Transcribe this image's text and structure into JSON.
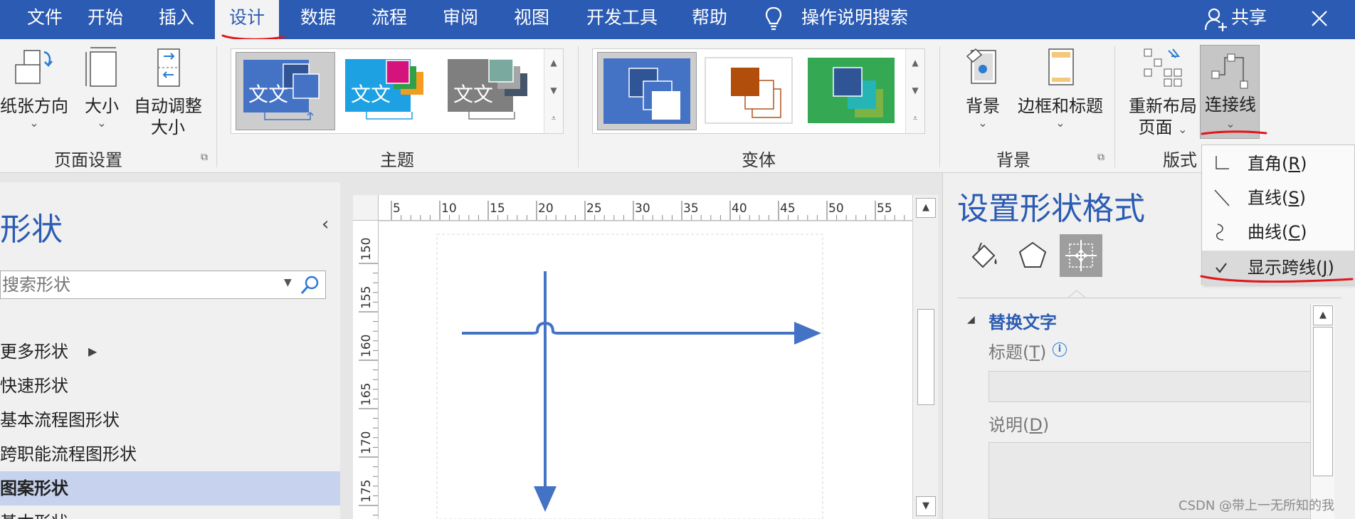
{
  "tabs": [
    {
      "label": "文件"
    },
    {
      "label": "开始"
    },
    {
      "label": "插入"
    },
    {
      "label": "设计",
      "active": true
    },
    {
      "label": "数据"
    },
    {
      "label": "流程"
    },
    {
      "label": "审阅"
    },
    {
      "label": "视图"
    },
    {
      "label": "开发工具"
    },
    {
      "label": "帮助"
    }
  ],
  "tell_me": "操作说明搜索",
  "share": "共享",
  "ribbon": {
    "page_setup": {
      "paper_orientation": "纸张方向",
      "size": "大小",
      "auto_size_line1": "自动调整",
      "auto_size_line2": "大小",
      "group_label": "页面设置"
    },
    "themes": {
      "group_label": "主题",
      "items": [
        {
          "text": "文文"
        },
        {
          "text": "文文"
        },
        {
          "text": "文文"
        }
      ]
    },
    "variants": {
      "group_label": "变体"
    },
    "backgrounds": {
      "background": "背景",
      "borders_titles": "边框和标题",
      "group_label": "背景"
    },
    "layout": {
      "relayout_line1": "重新布局",
      "relayout_line2": "页面",
      "connectors": "连接线",
      "group_label": "版式"
    }
  },
  "connector_menu": {
    "items": [
      {
        "label": "直角",
        "key": "R",
        "checked": false
      },
      {
        "label": "直线",
        "key": "S",
        "checked": false
      },
      {
        "label": "曲线",
        "key": "C",
        "checked": false
      },
      {
        "label": "显示跨线",
        "key": "J",
        "checked": true
      }
    ]
  },
  "shapes_pane": {
    "title": "形状",
    "search_placeholder": "搜索形状",
    "stencils": [
      {
        "label": "更多形状",
        "selected": false
      },
      {
        "label": "快速形状",
        "selected": false
      },
      {
        "label": "基本流程图形状",
        "selected": false
      },
      {
        "label": "跨职能流程图形状",
        "selected": false
      },
      {
        "label": "图案形状",
        "selected": true
      },
      {
        "label": "基本形状",
        "selected": false
      }
    ]
  },
  "ruler": {
    "horizontal_ticks": [
      "5",
      "10",
      "15",
      "20",
      "25",
      "30",
      "35",
      "40",
      "45",
      "50",
      "55"
    ],
    "vertical_ticks": [
      "150",
      "155",
      "160",
      "165",
      "170",
      "175"
    ]
  },
  "format_pane": {
    "title": "设置形状格式",
    "section": "替换文字",
    "title_field": {
      "label": "标题",
      "key": "T"
    },
    "description_field": {
      "label": "说明",
      "key": "D"
    }
  },
  "watermark": "CSDN @带上一无所知的我",
  "colors": {
    "accent_blue": "#2b5bb3",
    "connector_blue": "#4472c4",
    "annotation_red": "#e0161d"
  },
  "icons": {
    "tell_me": "lightbulb-icon",
    "share": "add-person-icon",
    "close": "close-icon",
    "search": "search-icon"
  }
}
